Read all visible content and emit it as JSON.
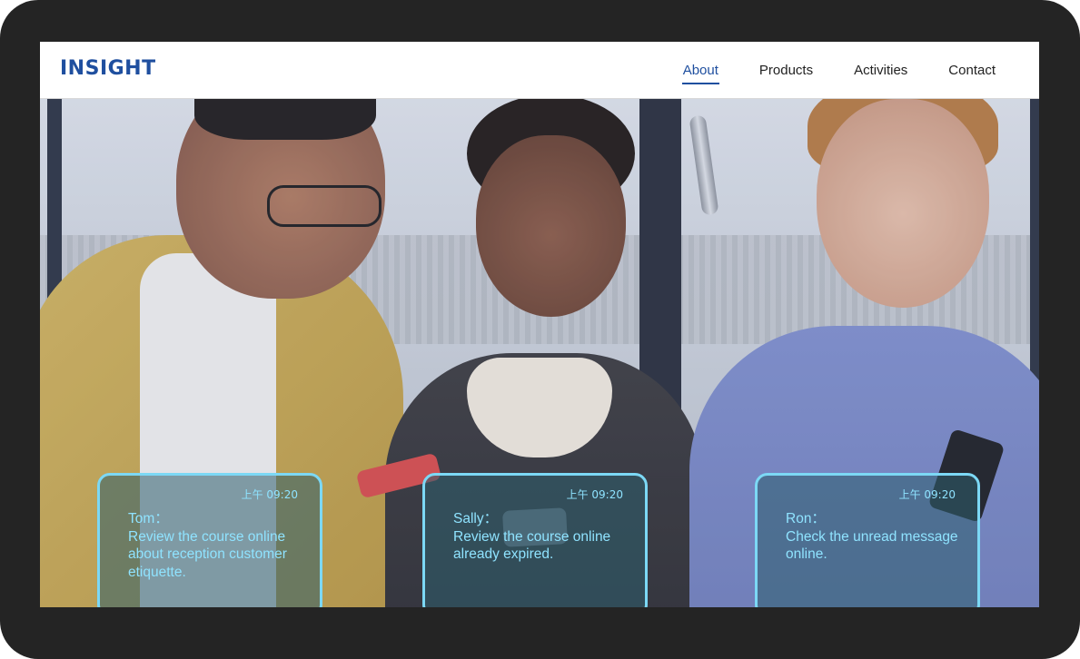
{
  "brand": {
    "logo": "INSIGHT",
    "accent": "#1f4f9f"
  },
  "nav": {
    "items": [
      {
        "label": "About",
        "active": true
      },
      {
        "label": "Products",
        "active": false
      },
      {
        "label": "Activities",
        "active": false
      },
      {
        "label": "Contact",
        "active": false
      }
    ]
  },
  "hero": {
    "photo": "three-students-looking-at-phones"
  },
  "cards": [
    {
      "time": "上午 09:20",
      "name": "Tom：",
      "message": "Review the course online about reception customer etiquette."
    },
    {
      "time": "上午 09:20",
      "name": "Sally：",
      "message": "Review the course online already expired."
    },
    {
      "time": "上午 09:20",
      "name": "Ron：",
      "message": "Check the unread message online."
    }
  ],
  "colors": {
    "device_frame": "#242424",
    "card_border": "#7cd8f5",
    "card_text": "#8fe3ff"
  }
}
